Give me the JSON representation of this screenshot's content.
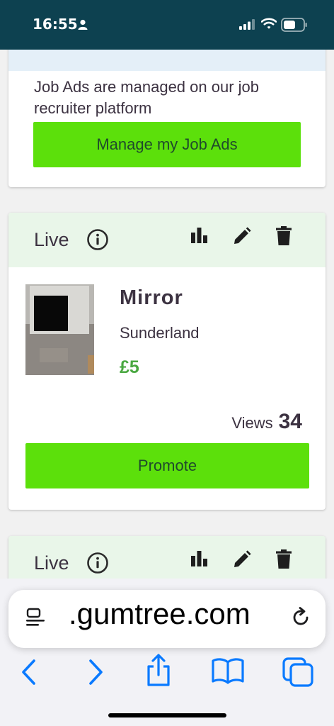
{
  "status_bar": {
    "time": "16:55"
  },
  "job_ads_card": {
    "text": "Job Ads are managed on our job recruiter platform",
    "button_label": "Manage my Job Ads"
  },
  "listings": [
    {
      "status": "Live",
      "title": "Mirror",
      "location": "Sunderland",
      "price": "£5",
      "views_label": "Views",
      "views_count": "34",
      "promote_label": "Promote"
    },
    {
      "status": "Live"
    }
  ],
  "browser": {
    "url": ".gumtree.com"
  },
  "colors": {
    "status_bar_bg": "#0d4150",
    "accent_green": "#5ce00b",
    "price_green": "#4aa841",
    "card_header_bg": "#e9f6e9",
    "text_dark": "#3c3241",
    "safari_blue": "#0a7aff"
  },
  "icons": [
    "person-icon",
    "signal-icon",
    "wifi-icon",
    "battery-icon",
    "info-icon",
    "stats-icon",
    "edit-icon",
    "delete-icon",
    "reader-icon",
    "reload-icon",
    "back-icon",
    "forward-icon",
    "share-icon",
    "bookmarks-icon",
    "tabs-icon"
  ]
}
